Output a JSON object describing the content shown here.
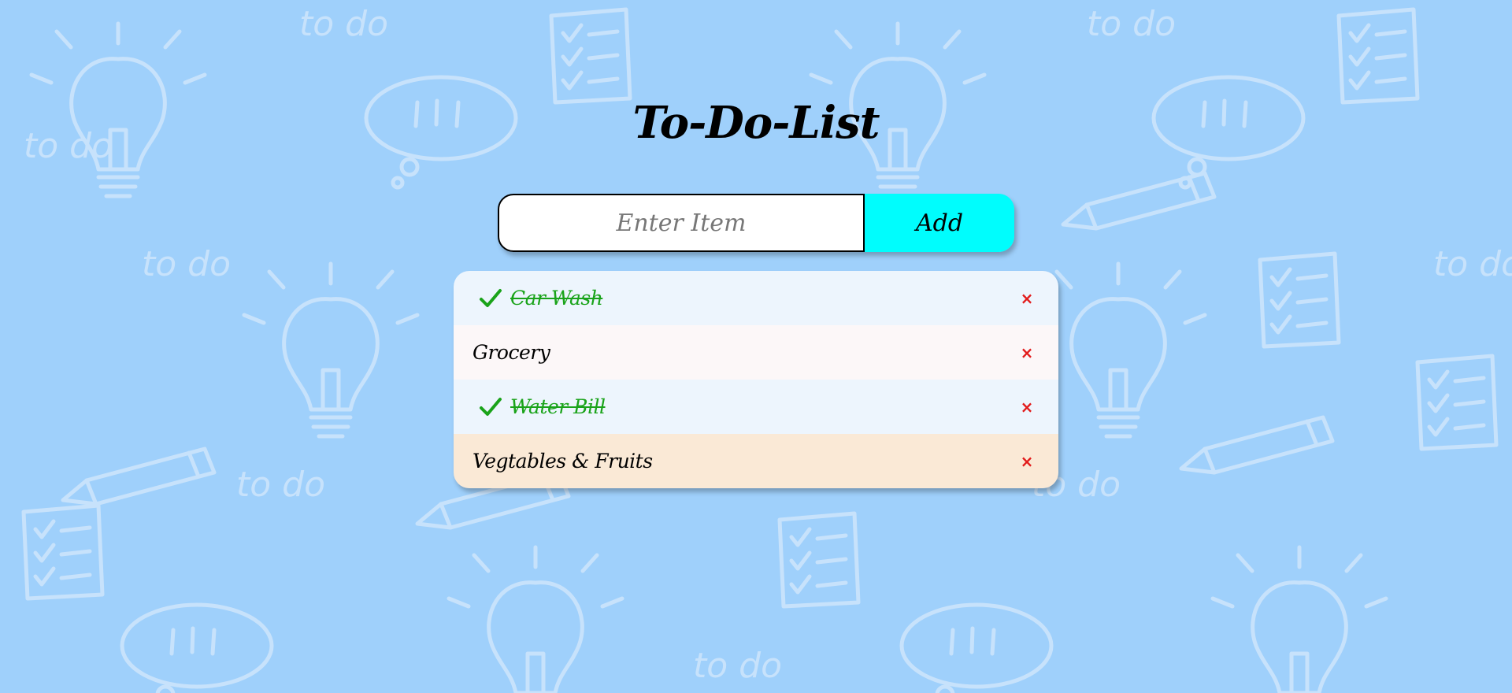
{
  "title": "To-Do-List",
  "input": {
    "value": "",
    "placeholder": "Enter Item"
  },
  "add_button": {
    "label": "Add"
  },
  "items": [
    {
      "text": "Car Wash",
      "done": true,
      "background": "#edf5fd"
    },
    {
      "text": "Grocery",
      "done": false,
      "background": "#fcf7f8"
    },
    {
      "text": "Water Bill",
      "done": true,
      "background": "#edf5fd"
    },
    {
      "text": "Vegtables & Fruits",
      "done": false,
      "background": "#fae9d6"
    }
  ],
  "delete_icon": "close-icon",
  "check_icon": "checkmark-icon",
  "colors": {
    "page_background": "#9fd0fb",
    "add_button": "#00fdfd",
    "done_text": "#1aa31a",
    "delete_icon": "#e21b1b"
  }
}
